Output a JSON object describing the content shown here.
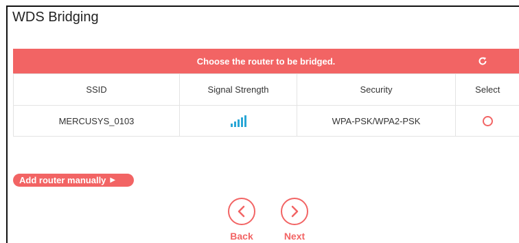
{
  "page": {
    "title": "WDS Bridging"
  },
  "table": {
    "caption": "Choose the router to be bridged.",
    "columns": [
      "SSID",
      "Signal Strength",
      "Security",
      "Select"
    ],
    "rows": [
      {
        "ssid": "MERCUSYS_0103",
        "signal_bars": 4,
        "security": "WPA-PSK/WPA2-PSK",
        "selected": false
      }
    ]
  },
  "actions": {
    "add_router": "Add router manually",
    "back": "Back",
    "next": "Next"
  },
  "colors": {
    "accent": "#f26464",
    "signal": "#2aa7d6"
  },
  "icons": {
    "refresh": "refresh-icon",
    "back": "chevron-left-icon",
    "next": "chevron-right-icon"
  }
}
